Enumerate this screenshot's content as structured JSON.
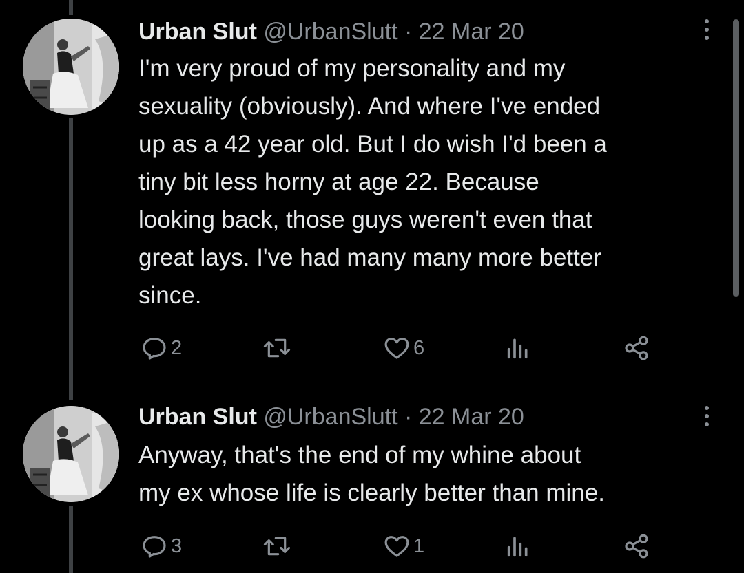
{
  "tweets": [
    {
      "display_name": "Urban Slut",
      "handle": "@UrbanSlutt",
      "separator": "·",
      "date": "22 Mar 20",
      "lines": [
        "I'm very proud of my personality and my",
        "sexuality (obviously). And where I've ended",
        "up as a 42 year old. But I do wish I'd been a",
        "tiny bit less horny at age 22. Because",
        "looking back, those guys weren't even that",
        "great lays. I've had many many more better",
        "since."
      ],
      "reply_count": "2",
      "like_count": "6"
    },
    {
      "display_name": "Urban Slut",
      "handle": "@UrbanSlutt",
      "separator": "·",
      "date": "22 Mar 20",
      "lines": [
        "Anyway, that's the end of my whine about",
        "my ex whose life is clearly better than mine."
      ],
      "reply_count": "3",
      "like_count": "1"
    }
  ],
  "icons": [
    "reply-icon",
    "retweet-icon",
    "like-icon",
    "views-icon",
    "share-icon",
    "more-icon"
  ],
  "colors": {
    "background": "#000000",
    "text": "#e7e9ea",
    "muted": "#8b9096",
    "thread_line": "#3e4144"
  }
}
